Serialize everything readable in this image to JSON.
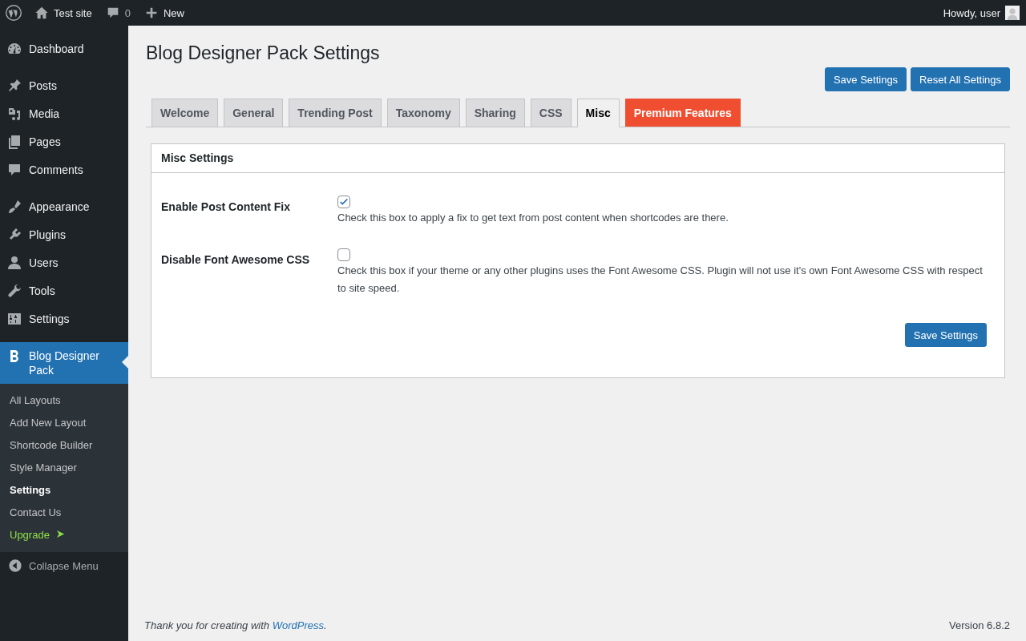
{
  "admin_bar": {
    "site": "Test site",
    "comments": "0",
    "new": "New",
    "greeting": "Howdy, user"
  },
  "menu_groups": [
    [
      {
        "label": "Dashboard",
        "selected": false
      }
    ],
    [
      {
        "label": "Posts",
        "selected": false
      },
      {
        "label": "Media",
        "selected": false
      },
      {
        "label": "Pages",
        "selected": false
      },
      {
        "label": "Comments",
        "selected": false
      }
    ],
    [
      {
        "label": "Appearance",
        "selected": false
      },
      {
        "label": "Plugins",
        "selected": false
      },
      {
        "label": "Users",
        "selected": false
      },
      {
        "label": "Tools",
        "selected": false
      },
      {
        "label": "Settings",
        "selected": false
      }
    ],
    [
      {
        "label": "Blog Designer Pack",
        "selected": true,
        "submenu": [
          {
            "label": "All Layouts",
            "selected": false,
            "kind": "normal"
          },
          {
            "label": "Add New Layout",
            "selected": false,
            "kind": "normal"
          },
          {
            "label": "Shortcode Builder",
            "selected": false,
            "kind": "normal"
          },
          {
            "label": "Style Manager",
            "selected": false,
            "kind": "normal"
          },
          {
            "label": "Settings",
            "selected": true,
            "kind": "normal"
          },
          {
            "label": "Contact Us",
            "selected": false,
            "kind": "normal"
          },
          {
            "label": "Upgrade",
            "selected": false,
            "kind": "upgrade"
          }
        ]
      }
    ]
  ],
  "collapse_menu": "Collapse Menu",
  "page_title": "Blog Designer Pack Settings",
  "header_buttons": [
    "Save Settings",
    "Reset All Settings"
  ],
  "tabs": [
    {
      "label": "Welcome",
      "selected": false,
      "kind": "normal"
    },
    {
      "label": "General",
      "selected": false,
      "kind": "normal"
    },
    {
      "label": "Trending Post",
      "selected": false,
      "kind": "normal"
    },
    {
      "label": "Taxonomy",
      "selected": false,
      "kind": "normal"
    },
    {
      "label": "Sharing",
      "selected": false,
      "kind": "normal"
    },
    {
      "label": "CSS",
      "selected": false,
      "kind": "normal"
    },
    {
      "label": "Misc",
      "selected": true,
      "kind": "normal"
    },
    {
      "label": "Premium Features",
      "selected": false,
      "kind": "premium"
    }
  ],
  "panel": {
    "title": "Misc Settings",
    "settings": [
      {
        "label": "Enable Post Content Fix",
        "checked": true,
        "description": "Check this box to apply a fix to get text from post content when shortcodes are there."
      },
      {
        "label": "Disable Font Awesome CSS",
        "checked": false,
        "description": "Check this box if your theme or any other plugins uses the Font Awesome CSS. Plugin will not use it's own Font Awesome CSS with respect to site speed."
      }
    ],
    "save_button": "Save Settings"
  },
  "footer": {
    "thanks_before": "Thank you for creating with",
    "link": "WordPress",
    "thanks_after": ".",
    "version": "Version 6.8.2"
  }
}
